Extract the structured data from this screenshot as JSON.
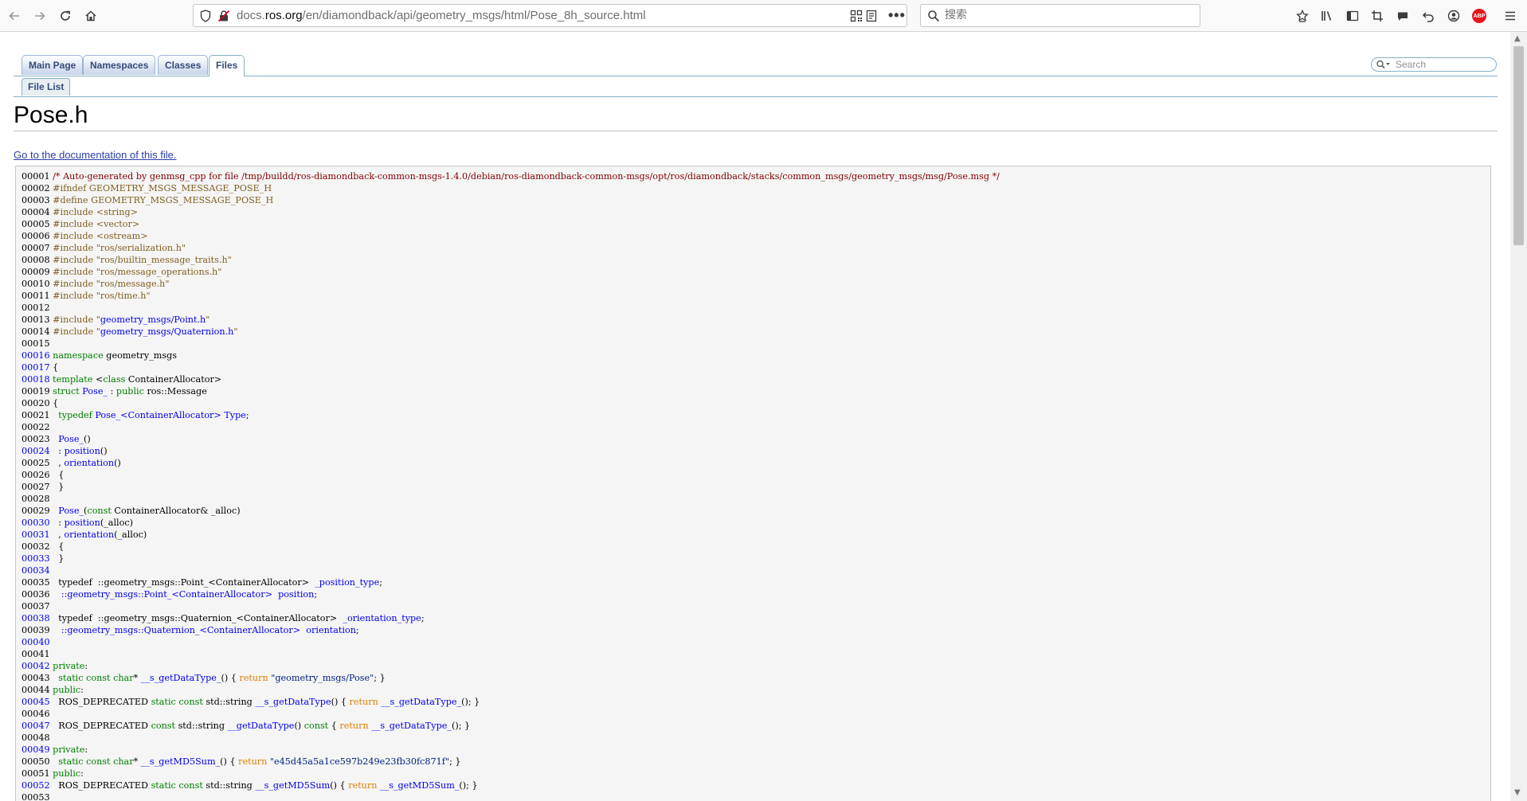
{
  "browser": {
    "url_prefix": "docs.",
    "url_host": "ros.org",
    "url_path": "/en/diamondback/api/geometry_msgs/html/Pose_8h_source.html",
    "search_placeholder": "搜索",
    "abp_label": "ABP"
  },
  "doxygen": {
    "tabs": [
      "Main Page",
      "Namespaces",
      "Classes",
      "Files"
    ],
    "active_tab": "Files",
    "subtab": "File List",
    "search_placeholder": "Search",
    "page_title": "Pose.h",
    "doc_link": "Go to the documentation of this file."
  },
  "code": [
    {
      "n": "00001",
      "link": false,
      "segs": [
        [
          "comment",
          "/* Auto-generated by genmsg_cpp for file /tmp/buildd/ros-diamondback-common-msgs-1.4.0/debian/ros-diamondback-common-msgs/opt/ros/diamondback/stacks/common_msgs/geometry_msgs/msg/Pose.msg */"
        ]
      ]
    },
    {
      "n": "00002",
      "link": false,
      "segs": [
        [
          "pp",
          "#ifndef GEOMETRY_MSGS_MESSAGE_POSE_H"
        ]
      ]
    },
    {
      "n": "00003",
      "link": false,
      "segs": [
        [
          "pp",
          "#define GEOMETRY_MSGS_MESSAGE_POSE_H"
        ]
      ]
    },
    {
      "n": "00004",
      "link": false,
      "segs": [
        [
          "pp",
          "#include <string>"
        ]
      ]
    },
    {
      "n": "00005",
      "link": false,
      "segs": [
        [
          "pp",
          "#include <vector>"
        ]
      ]
    },
    {
      "n": "00006",
      "link": false,
      "segs": [
        [
          "pp",
          "#include <ostream>"
        ]
      ]
    },
    {
      "n": "00007",
      "link": false,
      "segs": [
        [
          "pp",
          "#include \"ros/serialization.h\""
        ]
      ]
    },
    {
      "n": "00008",
      "link": false,
      "segs": [
        [
          "pp",
          "#include \"ros/builtin_message_traits.h\""
        ]
      ]
    },
    {
      "n": "00009",
      "link": false,
      "segs": [
        [
          "pp",
          "#include \"ros/message_operations.h\""
        ]
      ]
    },
    {
      "n": "00010",
      "link": false,
      "segs": [
        [
          "pp",
          "#include \"ros/message.h\""
        ]
      ]
    },
    {
      "n": "00011",
      "link": false,
      "segs": [
        [
          "pp",
          "#include \"ros/time.h\""
        ]
      ]
    },
    {
      "n": "00012",
      "link": false,
      "segs": []
    },
    {
      "n": "00013",
      "link": false,
      "segs": [
        [
          "pp",
          "#include \""
        ],
        [
          "lnk",
          "geometry_msgs/Point.h"
        ],
        [
          "pp",
          "\""
        ]
      ]
    },
    {
      "n": "00014",
      "link": false,
      "segs": [
        [
          "pp",
          "#include \""
        ],
        [
          "lnk",
          "geometry_msgs/Quaternion.h"
        ],
        [
          "pp",
          "\""
        ]
      ]
    },
    {
      "n": "00015",
      "link": false,
      "segs": []
    },
    {
      "n": "00016",
      "link": true,
      "segs": [
        [
          "kw",
          "namespace "
        ],
        [
          "txt",
          "geometry_msgs"
        ]
      ]
    },
    {
      "n": "00017",
      "link": true,
      "segs": [
        [
          "txt",
          "{"
        ]
      ]
    },
    {
      "n": "00018",
      "link": true,
      "segs": [
        [
          "kw",
          "template "
        ],
        [
          "txt",
          "<"
        ],
        [
          "kw",
          "class "
        ],
        [
          "txt",
          "ContainerAllocator>"
        ]
      ]
    },
    {
      "n": "00019",
      "link": false,
      "segs": [
        [
          "kw",
          "struct "
        ],
        [
          "lnk",
          "Pose_"
        ],
        [
          "txt",
          " : "
        ],
        [
          "kw",
          "public "
        ],
        [
          "txt",
          "ros::Message"
        ]
      ]
    },
    {
      "n": "00020",
      "link": false,
      "segs": [
        [
          "txt",
          "{"
        ]
      ]
    },
    {
      "n": "00021",
      "link": false,
      "segs": [
        [
          "txt",
          "  "
        ],
        [
          "kw",
          "typedef "
        ],
        [
          "lnk",
          "Pose_<ContainerAllocator>"
        ],
        [
          "txt",
          " "
        ],
        [
          "lnk",
          "Type"
        ],
        [
          "txt",
          ";"
        ]
      ]
    },
    {
      "n": "00022",
      "link": false,
      "segs": []
    },
    {
      "n": "00023",
      "link": false,
      "segs": [
        [
          "txt",
          "  "
        ],
        [
          "lnk",
          "Pose_"
        ],
        [
          "txt",
          "()"
        ]
      ]
    },
    {
      "n": "00024",
      "link": true,
      "segs": [
        [
          "txt",
          "  : "
        ],
        [
          "lnk",
          "position"
        ],
        [
          "txt",
          "()"
        ]
      ]
    },
    {
      "n": "00025",
      "link": false,
      "segs": [
        [
          "txt",
          "  , "
        ],
        [
          "lnk",
          "orientation"
        ],
        [
          "txt",
          "()"
        ]
      ]
    },
    {
      "n": "00026",
      "link": false,
      "segs": [
        [
          "txt",
          "  {"
        ]
      ]
    },
    {
      "n": "00027",
      "link": false,
      "segs": [
        [
          "txt",
          "  }"
        ]
      ]
    },
    {
      "n": "00028",
      "link": false,
      "segs": []
    },
    {
      "n": "00029",
      "link": false,
      "segs": [
        [
          "txt",
          "  "
        ],
        [
          "lnk",
          "Pose_"
        ],
        [
          "txt",
          "("
        ],
        [
          "kw",
          "const "
        ],
        [
          "txt",
          "ContainerAllocator& _alloc)"
        ]
      ]
    },
    {
      "n": "00030",
      "link": true,
      "segs": [
        [
          "txt",
          "  : "
        ],
        [
          "lnk",
          "position"
        ],
        [
          "txt",
          "(_alloc)"
        ]
      ]
    },
    {
      "n": "00031",
      "link": true,
      "segs": [
        [
          "txt",
          "  , "
        ],
        [
          "lnk",
          "orientation"
        ],
        [
          "txt",
          "(_alloc)"
        ]
      ]
    },
    {
      "n": "00032",
      "link": false,
      "segs": [
        [
          "txt",
          "  {"
        ]
      ]
    },
    {
      "n": "00033",
      "link": true,
      "segs": [
        [
          "txt",
          "  }"
        ]
      ]
    },
    {
      "n": "00034",
      "link": true,
      "segs": []
    },
    {
      "n": "00035",
      "link": false,
      "segs": [
        [
          "txt",
          "  typedef  ::geometry_msgs::Point_<ContainerAllocator>  "
        ],
        [
          "lnk",
          "_position_type"
        ],
        [
          "txt",
          ";"
        ]
      ]
    },
    {
      "n": "00036",
      "link": false,
      "segs": [
        [
          "txt",
          "   "
        ],
        [
          "lnk",
          "::geometry_msgs::Point_<ContainerAllocator>"
        ],
        [
          "txt",
          "  "
        ],
        [
          "lnk",
          "position"
        ],
        [
          "txt",
          ";"
        ]
      ]
    },
    {
      "n": "00037",
      "link": false,
      "segs": []
    },
    {
      "n": "00038",
      "link": true,
      "segs": [
        [
          "txt",
          "  typedef  ::geometry_msgs::Quaternion_<ContainerAllocator>  "
        ],
        [
          "lnk",
          "_orientation_type"
        ],
        [
          "txt",
          ";"
        ]
      ]
    },
    {
      "n": "00039",
      "link": false,
      "segs": [
        [
          "txt",
          "   "
        ],
        [
          "lnk",
          "::geometry_msgs::Quaternion_<ContainerAllocator>"
        ],
        [
          "txt",
          "  "
        ],
        [
          "lnk",
          "orientation"
        ],
        [
          "txt",
          ";"
        ]
      ]
    },
    {
      "n": "00040",
      "link": true,
      "segs": []
    },
    {
      "n": "00041",
      "link": false,
      "segs": []
    },
    {
      "n": "00042",
      "link": true,
      "segs": [
        [
          "kw",
          "private"
        ],
        [
          "txt",
          ":"
        ]
      ]
    },
    {
      "n": "00043",
      "link": false,
      "segs": [
        [
          "txt",
          "  "
        ],
        [
          "kw",
          "static const char"
        ],
        [
          "txt",
          "* "
        ],
        [
          "lnk",
          "__s_getDataType_"
        ],
        [
          "txt",
          "() { "
        ],
        [
          "kwflow",
          "return "
        ],
        [
          "str",
          "\"geometry_msgs/Pose\""
        ],
        [
          "txt",
          "; }"
        ]
      ]
    },
    {
      "n": "00044",
      "link": false,
      "segs": [
        [
          "kw",
          "public"
        ],
        [
          "txt",
          ":"
        ]
      ]
    },
    {
      "n": "00045",
      "link": true,
      "segs": [
        [
          "txt",
          "  ROS_DEPRECATED "
        ],
        [
          "kw",
          "static const "
        ],
        [
          "txt",
          "std::string "
        ],
        [
          "lnk",
          "__s_getDataType"
        ],
        [
          "txt",
          "() { "
        ],
        [
          "kwflow",
          "return "
        ],
        [
          "lnk",
          "__s_getDataType_"
        ],
        [
          "txt",
          "(); }"
        ]
      ]
    },
    {
      "n": "00046",
      "link": false,
      "segs": []
    },
    {
      "n": "00047",
      "link": true,
      "segs": [
        [
          "txt",
          "  ROS_DEPRECATED "
        ],
        [
          "kw",
          "const "
        ],
        [
          "txt",
          "std::string "
        ],
        [
          "lnk",
          "__getDataType"
        ],
        [
          "txt",
          "() "
        ],
        [
          "kw",
          "const "
        ],
        [
          "txt",
          "{ "
        ],
        [
          "kwflow",
          "return "
        ],
        [
          "lnk",
          "__s_getDataType_"
        ],
        [
          "txt",
          "(); }"
        ]
      ]
    },
    {
      "n": "00048",
      "link": false,
      "segs": []
    },
    {
      "n": "00049",
      "link": true,
      "segs": [
        [
          "kw",
          "private"
        ],
        [
          "txt",
          ":"
        ]
      ]
    },
    {
      "n": "00050",
      "link": false,
      "segs": [
        [
          "txt",
          "  "
        ],
        [
          "kw",
          "static const char"
        ],
        [
          "txt",
          "* "
        ],
        [
          "lnk",
          "__s_getMD5Sum_"
        ],
        [
          "txt",
          "() { "
        ],
        [
          "kwflow",
          "return "
        ],
        [
          "str",
          "\"e45d45a5a1ce597b249e23fb30fc871f\""
        ],
        [
          "txt",
          "; }"
        ]
      ]
    },
    {
      "n": "00051",
      "link": false,
      "segs": [
        [
          "kw",
          "public"
        ],
        [
          "txt",
          ":"
        ]
      ]
    },
    {
      "n": "00052",
      "link": true,
      "segs": [
        [
          "txt",
          "  ROS_DEPRECATED "
        ],
        [
          "kw",
          "static const "
        ],
        [
          "txt",
          "std::string "
        ],
        [
          "lnk",
          "__s_getMD5Sum"
        ],
        [
          "txt",
          "() { "
        ],
        [
          "kwflow",
          "return "
        ],
        [
          "lnk",
          "__s_getMD5Sum_"
        ],
        [
          "txt",
          "(); }"
        ]
      ]
    },
    {
      "n": "00053",
      "link": false,
      "segs": []
    }
  ]
}
